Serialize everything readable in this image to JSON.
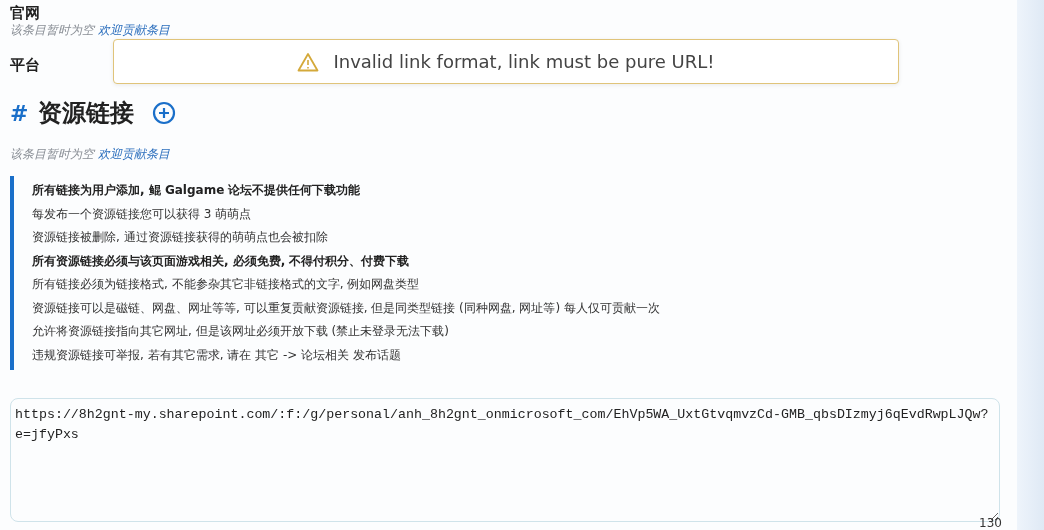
{
  "sections": [
    {
      "title": "官网",
      "empty_text": "该条目暂时为空",
      "contribute_link": "欢迎贡献条目"
    },
    {
      "title": "平台"
    }
  ],
  "toast": {
    "message": "Invalid link format, link must be pure URL!"
  },
  "resources": {
    "hash": "#",
    "title": "资源链接",
    "empty_text": "该条目暂时为空",
    "contribute_link": "欢迎贡献条目"
  },
  "notice": [
    {
      "text": "所有链接为用户添加, 鲲 Galgame 论坛不提供任何下载功能",
      "bold": true
    },
    {
      "text": "每发布一个资源链接您可以获得 3 萌萌点",
      "bold": false
    },
    {
      "text": "资源链接被删除, 通过资源链接获得的萌萌点也会被扣除",
      "bold": false
    },
    {
      "text": "所有资源链接必须与该页面游戏相关, 必须免费, 不得付积分、付费下载",
      "bold": true
    },
    {
      "text": "所有链接必须为链接格式, 不能参杂其它非链接格式的文字, 例如网盘类型",
      "bold": false
    },
    {
      "text": "资源链接可以是磁链、网盘、网址等等, 可以重复贡献资源链接, 但是同类型链接 (同种网盘, 网址等) 每人仅可贡献一次",
      "bold": false
    },
    {
      "text": "允许将资源链接指向其它网址, 但是该网址必须开放下载 (禁止未登录无法下载)",
      "bold": false
    },
    {
      "text": "违规资源链接可举报, 若有其它需求, 请在 其它 -> 论坛相关 发布话题",
      "bold": false
    }
  ],
  "link_input": {
    "value": "https://8h2gnt-my.sharepoint.com/:f:/g/personal/anh_8h2gnt_onmicrosoft_com/EhVp5WA_UxtGtvqmvzCd-GMB_qbsDIzmyj6qEvdRwpLJQw?e=jfyPxs",
    "count": "130"
  }
}
